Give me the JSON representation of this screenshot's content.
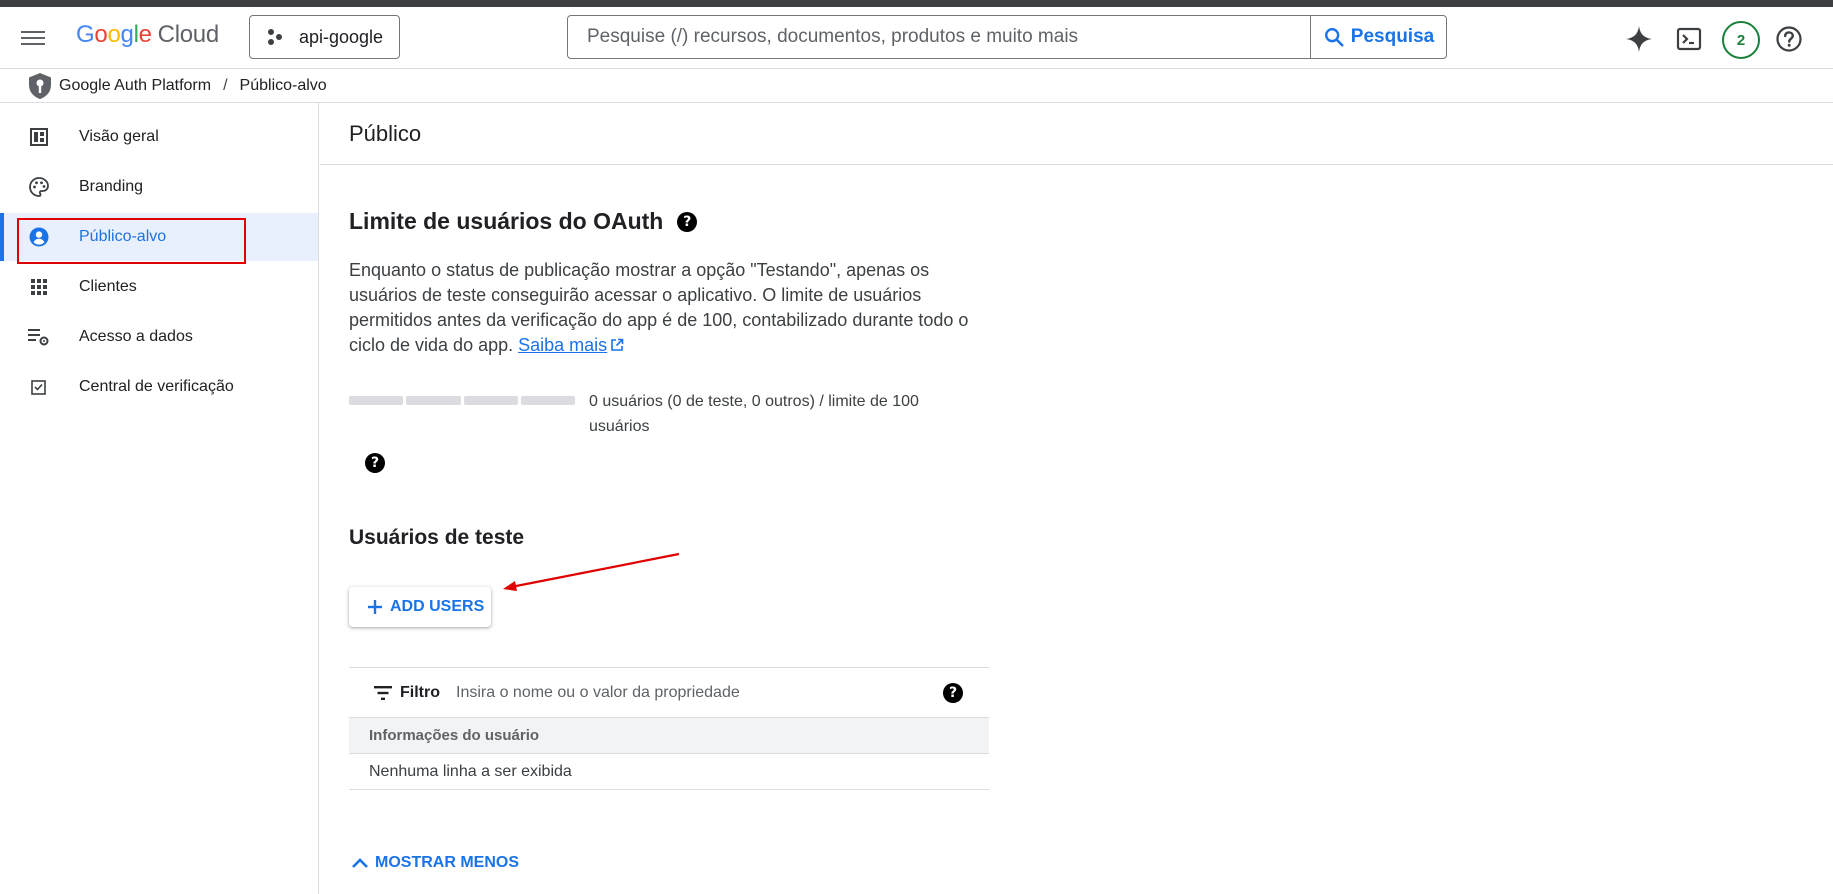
{
  "header": {
    "logo": {
      "g1": "G",
      "g2": "o",
      "g3": "o",
      "g4": "g",
      "g5": "l",
      "g6": "e",
      "cloud": "Cloud"
    },
    "project": "api-google",
    "search_placeholder": "Pesquise (/) recursos, documentos, produtos e muito mais",
    "search_button": "Pesquisa",
    "notifications_count": "2",
    "icons": [
      "menu-icon",
      "project-icon",
      "search-icon",
      "gemini-sparkle-icon",
      "cloud-shell-icon",
      "help-icon"
    ]
  },
  "breadcrumb": {
    "items": [
      "Google Auth Platform",
      "Público-alvo"
    ],
    "separator": "/"
  },
  "sidebar": {
    "items": [
      {
        "label": "Visão geral",
        "icon": "dashboard-icon"
      },
      {
        "label": "Branding",
        "icon": "palette-icon"
      },
      {
        "label": "Público-alvo",
        "icon": "account-circle-icon",
        "active": true
      },
      {
        "label": "Clientes",
        "icon": "apps-grid-icon"
      },
      {
        "label": "Acesso a dados",
        "icon": "data-settings-icon"
      },
      {
        "label": "Central de verificação",
        "icon": "verified-checkbox-icon"
      }
    ]
  },
  "content": {
    "page_title": "Público",
    "oauth": {
      "title": "Limite de usuários do OAuth",
      "description": "Enquanto o status de publicação mostrar a opção \"Testando\", apenas os usuários de teste conseguirão acessar o aplicativo. O limite de usuários permitidos antes da verificação do app é de 100, contabilizado durante todo o ciclo de vida do app.",
      "learn_more": "Saiba mais",
      "usage_text": "0 usuários (0 de teste, 0 outros) / limite de 100 usuários",
      "usage_fraction": 0
    },
    "test_users": {
      "title": "Usuários de teste",
      "add_button": "ADD USERS",
      "filter_label": "Filtro",
      "filter_placeholder": "Insira o nome ou o valor da propriedade",
      "column_header": "Informações do usuário",
      "empty_message": "Nenhuma linha a ser exibida"
    },
    "show_less": "MOSTRAR MENOS"
  },
  "colors": {
    "accent": "#1a73e8",
    "annotation_red": "#e00000",
    "avatar_green": "#188038"
  }
}
